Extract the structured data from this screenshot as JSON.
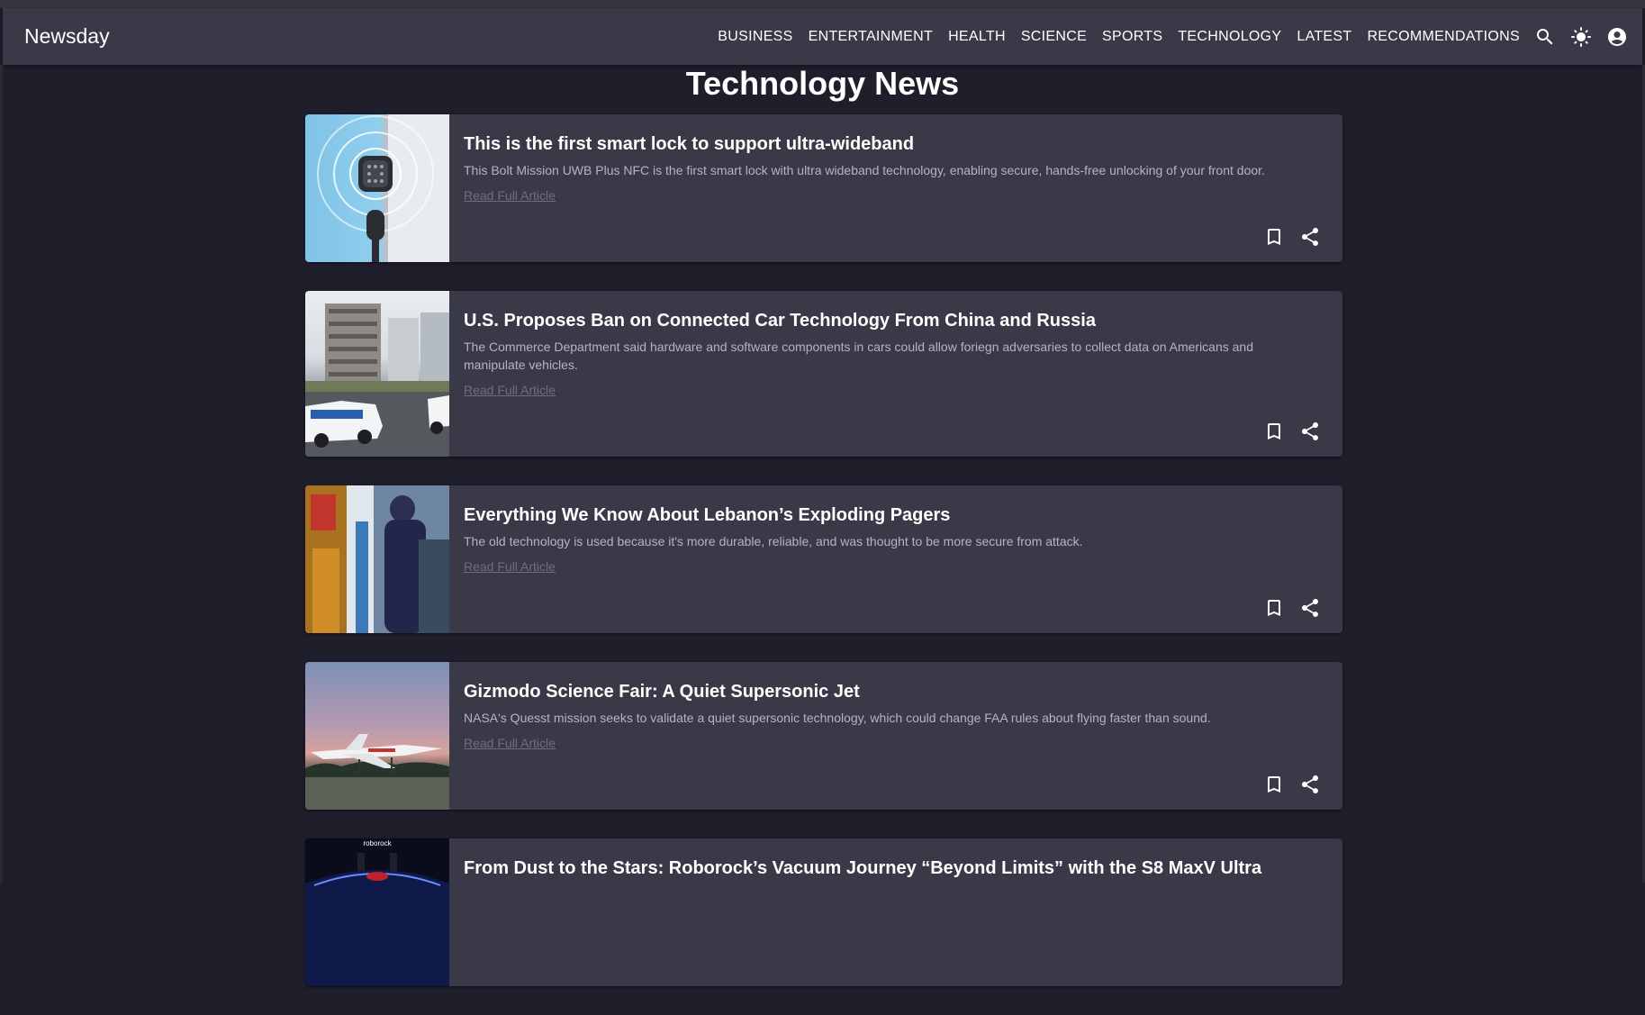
{
  "app": {
    "brand": "Newsday"
  },
  "nav": {
    "items": [
      {
        "label": "BUSINESS"
      },
      {
        "label": "ENTERTAINMENT"
      },
      {
        "label": "HEALTH"
      },
      {
        "label": "SCIENCE"
      },
      {
        "label": "SPORTS"
      },
      {
        "label": "TECHNOLOGY"
      },
      {
        "label": "LATEST"
      },
      {
        "label": "RECOMMENDATIONS"
      }
    ],
    "icons": [
      "search-icon",
      "light-mode-icon",
      "account-circle-icon"
    ]
  },
  "page": {
    "title": "Technology News"
  },
  "read_more_label": "Read Full Article",
  "articles": [
    {
      "title": "This is the first smart lock to support ultra-wideband",
      "description": "This Bolt Mission UWB Plus NFC is the first smart lock with ultra wideband technology, enabling secure, hands-free unlocking of your front door."
    },
    {
      "title": "U.S. Proposes Ban on Connected Car Technology From China and Russia",
      "description": "The Commerce Department said hardware and software components in cars could allow foriegn adversaries to collect data on Americans and manipulate vehicles."
    },
    {
      "title": "Everything We Know About Lebanon’s Exploding Pagers",
      "description": "The old technology is used because it's more durable, reliable, and was thought to be more secure from attack."
    },
    {
      "title": "Gizmodo Science Fair: A Quiet Supersonic Jet",
      "description": "NASA's Quesst mission seeks to validate a quiet supersonic technology, which could change FAA rules about flying faster than sound."
    },
    {
      "title": "From Dust to the Stars: Roborock’s Vacuum Journey “Beyond Limits” with the S8 MaxV Ultra",
      "description": "",
      "thumb_text": "roborock"
    }
  ],
  "colors": {
    "background": "#1f1e2b",
    "appbar": "#3a3947",
    "card": "#3a3947",
    "text": "#ffffff",
    "muted_text": "#b5b4c0",
    "link": "#6f6e7b"
  }
}
